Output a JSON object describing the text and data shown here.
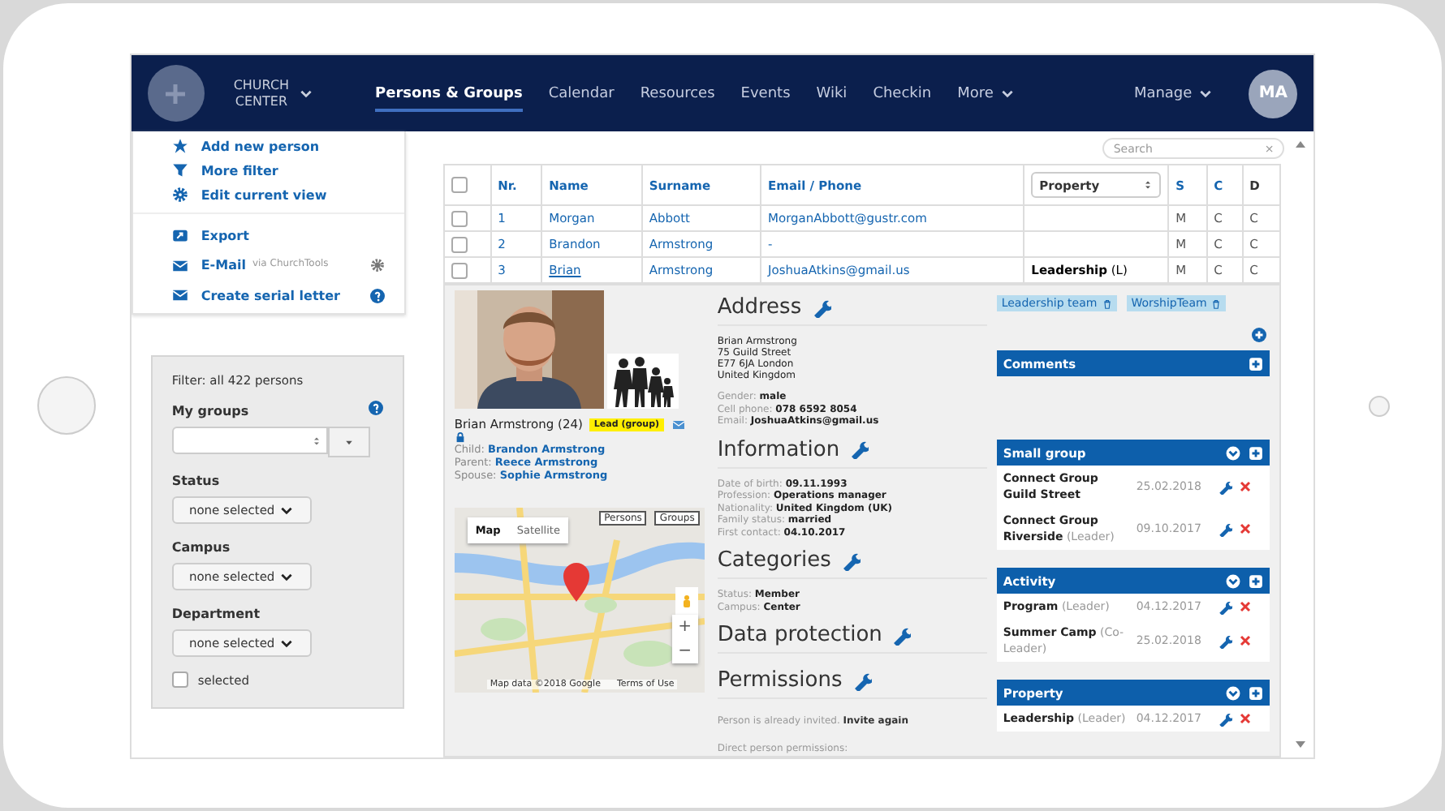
{
  "nav": {
    "logo_lines": [
      "CHURCH",
      "CENTER"
    ],
    "items": [
      {
        "label": "Persons & Groups",
        "selected": true
      },
      {
        "label": "Calendar",
        "selected": false
      },
      {
        "label": "Resources",
        "selected": false
      },
      {
        "label": "Events",
        "selected": false
      },
      {
        "label": "Wiki",
        "selected": false
      },
      {
        "label": "Checkin",
        "selected": false
      },
      {
        "label": "More",
        "selected": false
      }
    ],
    "manage": "Manage",
    "avatar": "MA"
  },
  "actions": [
    [
      {
        "label": "Add new person"
      },
      {
        "label": "More filter"
      },
      {
        "label": "Edit current view"
      }
    ],
    [
      {
        "label": "Export"
      },
      {
        "label": "E-Mail",
        "note": "via ChurchTools"
      },
      {
        "label": "Create serial letter"
      }
    ]
  ],
  "filter": {
    "summary": "Filter: all 422 persons",
    "my_groups": "My groups",
    "dropdowns": [
      {
        "label": "Status",
        "value": "none selected"
      },
      {
        "label": "Campus",
        "value": "none selected"
      },
      {
        "label": "Department",
        "value": "none selected"
      }
    ],
    "selected_only": {
      "label": "selected",
      "checked": false
    }
  },
  "search": {
    "placeholder": "Search",
    "clear": "×"
  },
  "table": {
    "select_all": {
      "checked": false
    },
    "columns": [
      "Nr.",
      "Name",
      "Surname",
      "Email / Phone",
      "Property",
      "S",
      "C",
      "D"
    ],
    "rows": [
      {
        "checked": false,
        "cells": [
          "1",
          "Morgan",
          "Abbott",
          "MorganAbbott@gustr.com"
        ],
        "flags": [
          "M",
          "C",
          "C"
        ]
      },
      {
        "checked": false,
        "cells": [
          "2",
          "Brandon",
          "Armstrong",
          "-"
        ],
        "flags": [
          "M",
          "C",
          "C"
        ]
      },
      {
        "checked": false,
        "cells": [
          "3",
          "Brian",
          "Armstrong",
          "JoshuaAtkins@gmail.us"
        ],
        "property": "**Leadership** (L)",
        "flags": [
          "M",
          "C",
          "C"
        ]
      }
    ]
  },
  "person": {
    "name": "Brian Armstrong (24)",
    "badge": "Lead (group)",
    "relations": [
      {
        "role": "Child:",
        "name": "Brandon Armstrong"
      },
      {
        "role": "Parent:",
        "name": "Reece Armstrong"
      },
      {
        "role": "Spouse:",
        "name": "Sophie Armstrong"
      }
    ],
    "map": {
      "types": [
        {
          "label": "Map",
          "selected": true
        },
        {
          "label": "Satellite",
          "selected": false
        }
      ],
      "layers": [
        "Persons",
        "Groups"
      ],
      "zoom": [
        "+",
        "−"
      ],
      "attribution": "Map data ©2018 Google",
      "terms": "Terms of Use"
    }
  },
  "sections": [
    {
      "title": "Address",
      "lines": [
        "Brian Armstrong",
        "75 Guild Street",
        "E77 6JA London",
        "United Kingdom"
      ],
      "fields": [
        {
          "label": "Gender:",
          "value": "male"
        },
        {
          "label": "Cell phone:",
          "value": "078 6592 8054"
        },
        {
          "label": "Email:",
          "value": "JoshuaAtkins@gmail.us"
        }
      ]
    },
    {
      "title": "Information",
      "fields": [
        {
          "label": "Date of birth:",
          "value": "09.11.1993"
        },
        {
          "label": "Profession:",
          "value": "Operations manager"
        },
        {
          "label": "Nationality:",
          "value": "United Kingdom (UK)"
        },
        {
          "label": "Family status:",
          "value": "married"
        },
        {
          "label": "First contact:",
          "value": "04.10.2017"
        }
      ]
    },
    {
      "title": "Categories",
      "fields": [
        {
          "label": "Status:",
          "value": "Member"
        },
        {
          "label": "Campus:",
          "value": "Center"
        }
      ]
    },
    {
      "title": "Data protection"
    },
    {
      "title": "Permissions",
      "notes": [
        {
          "text": "Person is already invited.",
          "link": "Invite again"
        },
        {
          "text": "Direct person permissions:"
        }
      ]
    }
  ],
  "tags": [
    "Leadership team",
    "WorshipTeam"
  ],
  "panels": [
    {
      "kind": "empty",
      "title": "Comments"
    },
    {
      "kind": "list",
      "title": "Small group",
      "entries": [
        {
          "name": "Connect Group Guild Street",
          "date": "25.02.2018"
        },
        {
          "name": "Connect Group Riverside",
          "role": "(Leader)",
          "date": "09.10.2017"
        }
      ]
    },
    {
      "kind": "list",
      "title": "Activity",
      "entries": [
        {
          "name": "Program",
          "role": "(Leader)",
          "date": "04.12.2017"
        },
        {
          "name": "Summer Camp",
          "role": "(Co-Leader)",
          "date": "25.02.2018"
        }
      ]
    },
    {
      "kind": "list",
      "title": "Property",
      "entries": [
        {
          "name": "Leadership",
          "role": "(Leader)",
          "date": "04.12.2017"
        }
      ]
    }
  ]
}
